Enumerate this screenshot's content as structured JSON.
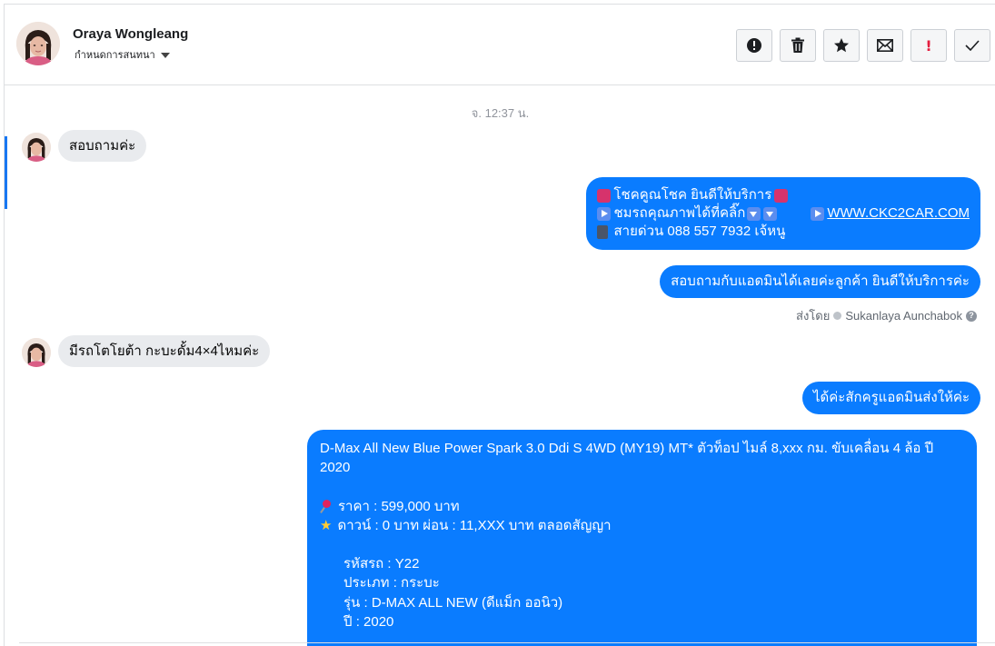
{
  "header": {
    "contact_name": "Oraya Wongleang",
    "contact_sub": "กำหนดการสนทนา",
    "actions": [
      {
        "icon": "alert-circle-icon",
        "name": "report-button"
      },
      {
        "icon": "trash-icon",
        "name": "delete-button"
      },
      {
        "icon": "star-icon",
        "name": "star-button"
      },
      {
        "icon": "envelope-icon",
        "name": "mark-unread-button"
      },
      {
        "icon": "exclamation-icon",
        "name": "spam-button",
        "text": "!"
      },
      {
        "icon": "checkmark-icon",
        "name": "done-button"
      }
    ]
  },
  "conversation": {
    "timestamp": "จ. 12:37 น.",
    "msg1": "สอบถามค่ะ",
    "msg2": {
      "line1": "โชคคูณโชค ยินดีให้บริการ",
      "line2_text": "ชมรถคุณภาพได้ที่คลิ๊ก",
      "line2_link": "WWW.CKC2CAR.COM",
      "line3": "สายด่วน 088 557 7932 เจ้หนู"
    },
    "msg3": "สอบถามกับแอดมินได้เลยค่ะลูกค้า ยินดีให้บริการค่ะ",
    "sent_by": {
      "prefix": "ส่งโดย",
      "name": "Sukanlaya Aunchabok",
      "help": "?"
    },
    "msg4": "มีรถโตโยต้า กะบะดั้ม4×4ไหมค่ะ",
    "msg5": "ได้ค่ะสักครูแอดมินส่งให้ค่ะ",
    "msg6": {
      "line1": "D-Max All New Blue Power Spark 3.0 Ddi S 4WD (MY19) MT* ตัวท็อป ไมล์ 8,xxx กม. ขับเคลื่อน 4 ล้อ ปี",
      "line2": "2020",
      "price": "ราคา : 599,000 บาท",
      "down": "ดาวน์ : 0 บาท ผ่อน : 11,XXX บาท ตลอดสัญญา",
      "code": "รหัสรถ : Y22",
      "type": "ประเภท : กระบะ",
      "model": "รุ่น : D-MAX ALL NEW (ดีแม็ก ออนิว)",
      "year": "ปี : 2020"
    }
  },
  "colors": {
    "outgoing_bubble": "#0a7cff",
    "incoming_bubble": "#e9ebee",
    "accent": "#1877f2"
  }
}
